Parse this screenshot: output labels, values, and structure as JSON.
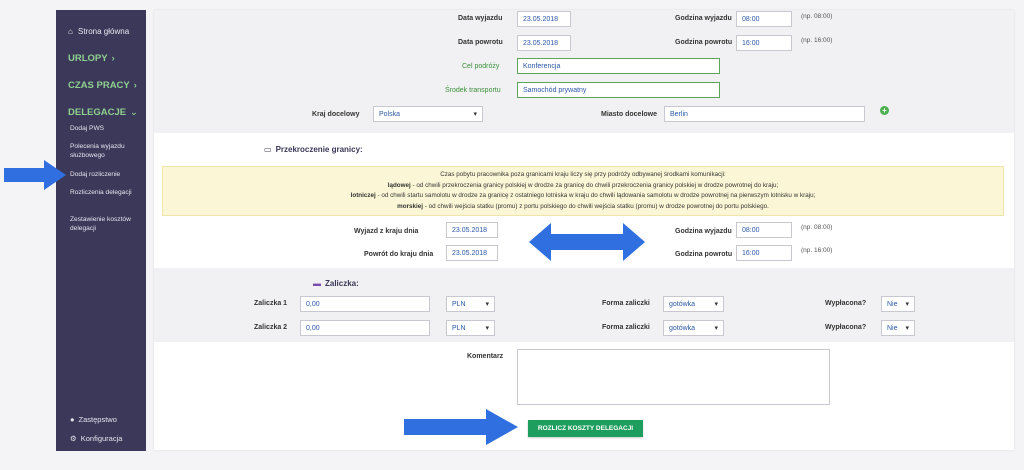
{
  "sidebar": {
    "home": "Strona główna",
    "urlopy": "URLOPY",
    "czas_pracy": "CZAS PRACY",
    "delegacje": "DELEGACJE",
    "items": [
      "Dodaj PWS",
      "Polecenia wyjazdu służbowego",
      "Dodaj rozliczenie",
      "Rozliczenia delegacji",
      "Zestawienie kosztów delegacji"
    ],
    "zastepstwo": "Zastępstwo",
    "konfiguracja": "Konfiguracja"
  },
  "trip": {
    "data_wyjazdu_label": "Data wyjazdu",
    "data_wyjazdu": "23.05.2018",
    "godzina_wyjazdu_label": "Godzina wyjazdu",
    "godzina_wyjazdu": "08:00",
    "godzina_wyjazdu_hint": "(np. 08:00)",
    "data_powrotu_label": "Data powrotu",
    "data_powrotu": "23.05.2018",
    "godzina_powrotu_label": "Godzina powrotu",
    "godzina_powrotu": "16:00",
    "godzina_powrotu_hint": "(np. 16:00)",
    "cel_label": "Cel podróży",
    "cel": "Konferencja",
    "srodek_label": "Środek transportu",
    "srodek": "Samochód prywatny",
    "kraj_label": "Kraj docelowy",
    "kraj": "Polska",
    "miasto_label": "Miasto docelowe",
    "miasto": "Berlin"
  },
  "border": {
    "title": "Przekroczenie granicy:",
    "info_line1": "Czas pobytu pracownika poza granicami kraju liczy się przy podróży odbywanej środkami komunikacji:",
    "info_l2_bold": "lądowej",
    "info_l2": " - od chwili przekroczenia granicy polskiej w drodze za granicę do chwili przekroczenia granicy polskiej w drodze powrotnej do kraju;",
    "info_l3_bold": "lotniczej",
    "info_l3": " - od chwili startu samolotu w drodze za granicę z ostatniego lotniska w kraju do chwili lądowania samolotu w drodze powrotnej na pierwszym lotnisku w kraju;",
    "info_l4_bold": "morskiej",
    "info_l4": " - od chwili wejścia statku (promu) z portu polskiego do chwili wejścia statku (promu) w drodze powrotnej do portu polskiego.",
    "wyjazd_label": "Wyjazd z kraju dnia",
    "wyjazd": "23.05.2018",
    "powrot_label": "Powrót do kraju dnia",
    "powrot": "23.05.2018",
    "godzina_wyjazdu_label": "Godzina wyjazdu",
    "godzina_wyjazdu": "08:00",
    "godzina_wyjazdu_hint": "(np. 08:00)",
    "godzina_powrotu_label": "Godzina powrotu",
    "godzina_powrotu": "16:00",
    "godzina_powrotu_hint": "(np. 16:00)"
  },
  "advance": {
    "title": "Zaliczka:",
    "rows": [
      {
        "label": "Zaliczka 1",
        "amount": "0,00",
        "currency": "PLN",
        "forma_label": "Forma zaliczki",
        "forma": "gotówka",
        "wyplacona_label": "Wypłacona?",
        "wyplacona": "Nie"
      },
      {
        "label": "Zaliczka 2",
        "amount": "0,00",
        "currency": "PLN",
        "forma_label": "Forma zaliczki",
        "forma": "gotówka",
        "wyplacona_label": "Wypłacona?",
        "wyplacona": "Nie"
      }
    ]
  },
  "comment": {
    "label": "Komentarz",
    "value": ""
  },
  "submit_label": "ROZLICZ KOSZTY DELEGACJI",
  "colors": {
    "sidebar_bg": "#3b3859",
    "accent_green": "#1e9e5e",
    "arrow_blue": "#2f6fe0",
    "info_bg": "#fbf7d6"
  }
}
